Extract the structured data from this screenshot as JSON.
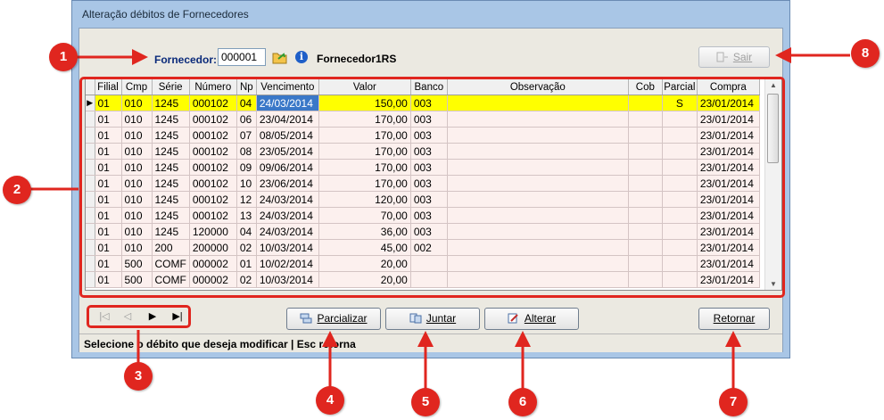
{
  "window": {
    "title": "Alteração débitos de Fornecedores"
  },
  "header": {
    "fornecedor_label": "Fornecedor:",
    "fornecedor_code": "000001",
    "fornecedor_name": "Fornecedor1RS",
    "sair_label": "Sair"
  },
  "grid": {
    "columns": [
      "Filial",
      "Cmp",
      "Série",
      "Número",
      "Np",
      "Vencimento",
      "Valor",
      "Banco",
      "Observação",
      "Cob",
      "Parcial",
      "Compra"
    ],
    "rows": [
      [
        "01",
        "010",
        "1245",
        "000102",
        "04",
        "24/03/2014",
        "150,00",
        "003",
        "",
        "",
        "S",
        "23/01/2014"
      ],
      [
        "01",
        "010",
        "1245",
        "000102",
        "06",
        "23/04/2014",
        "170,00",
        "003",
        "",
        "",
        "",
        "23/01/2014"
      ],
      [
        "01",
        "010",
        "1245",
        "000102",
        "07",
        "08/05/2014",
        "170,00",
        "003",
        "",
        "",
        "",
        "23/01/2014"
      ],
      [
        "01",
        "010",
        "1245",
        "000102",
        "08",
        "23/05/2014",
        "170,00",
        "003",
        "",
        "",
        "",
        "23/01/2014"
      ],
      [
        "01",
        "010",
        "1245",
        "000102",
        "09",
        "09/06/2014",
        "170,00",
        "003",
        "",
        "",
        "",
        "23/01/2014"
      ],
      [
        "01",
        "010",
        "1245",
        "000102",
        "10",
        "23/06/2014",
        "170,00",
        "003",
        "",
        "",
        "",
        "23/01/2014"
      ],
      [
        "01",
        "010",
        "1245",
        "000102",
        "12",
        "24/03/2014",
        "120,00",
        "003",
        "",
        "",
        "",
        "23/01/2014"
      ],
      [
        "01",
        "010",
        "1245",
        "000102",
        "13",
        "24/03/2014",
        "70,00",
        "003",
        "",
        "",
        "",
        "23/01/2014"
      ],
      [
        "01",
        "010",
        "1245",
        "120000",
        "04",
        "24/03/2014",
        "36,00",
        "003",
        "",
        "",
        "",
        "23/01/2014"
      ],
      [
        "01",
        "010",
        "200",
        "200000",
        "02",
        "10/03/2014",
        "45,00",
        "002",
        "",
        "",
        "",
        "23/01/2014"
      ],
      [
        "01",
        "500",
        "COMF",
        "000002",
        "01",
        "10/02/2014",
        "20,00",
        "",
        "",
        "",
        "",
        "23/01/2014"
      ],
      [
        "01",
        "500",
        "COMF",
        "000002",
        "02",
        "10/03/2014",
        "20,00",
        "",
        "",
        "",
        "",
        "23/01/2014"
      ]
    ],
    "selected_row": 0
  },
  "navigator": {
    "first": "|◁",
    "prev": "◁",
    "next": "▶",
    "last": "▶|"
  },
  "buttons": {
    "parcializar": "Parcializar",
    "juntar": "Juntar",
    "alterar": "Alterar",
    "retornar": "Retornar"
  },
  "status": {
    "text": "Selecione o débito que deseja modificar  |  Esc retorna"
  },
  "callouts": [
    "1",
    "2",
    "3",
    "4",
    "5",
    "6",
    "7",
    "8"
  ],
  "colors": {
    "callout": "#e0261f",
    "selected_row": "#ffff00",
    "row_bg": "#fcf0ee"
  }
}
